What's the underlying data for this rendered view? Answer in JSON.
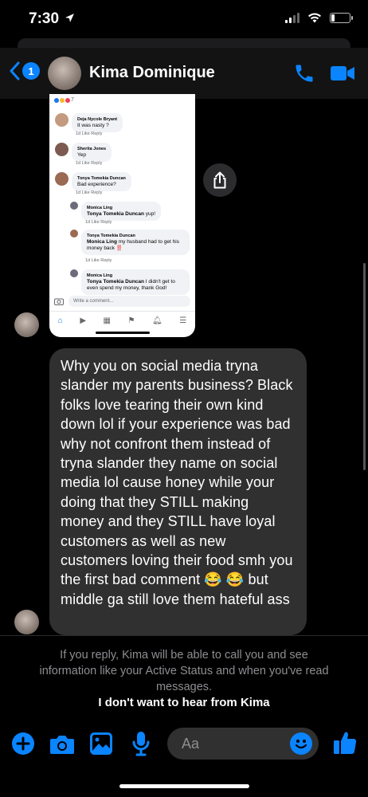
{
  "status_bar": {
    "time": "7:30"
  },
  "header": {
    "back_badge": "1",
    "contact_name": "Kima Dominique"
  },
  "shared_screenshot": {
    "reaction_count": "7",
    "comments": [
      {
        "name": "Deja Nycole Bryant",
        "text": "It was nasty ?",
        "meta": "1d   Like   Reply"
      },
      {
        "name": "Sherita Jones",
        "text": "Yep",
        "meta": "1d   Like   Reply"
      },
      {
        "name": "Tonya Tomekia Duncan",
        "text": "Bad experience?",
        "meta": "1d   Like   Reply"
      }
    ],
    "replies": [
      {
        "name": "Monica Ling",
        "mention": "Tonya Tomekia Duncan",
        "text": " yup!",
        "meta": "1d   Like   Reply"
      },
      {
        "name": "Tonya Tomekia Duncan",
        "mention": "Monica Ling",
        "text": " my husband had to get his money back ‼️",
        "meta": "1d   Like   Reply"
      },
      {
        "name": "Monica Ling",
        "mention": "Tonya Tomekia Duncan",
        "text": " I didn't get to even spend my money, thank God!"
      }
    ],
    "write_placeholder": "Write a comment..."
  },
  "message": {
    "text": "Why you on social media tryna slander my parents business? Black folks love tearing their own kind down lol if your experience was bad why not confront them instead of tryna slander they name on social media lol cause honey while your doing that they STILL making money and they STILL have loyal customers as well as new customers loving their food smh you the first bad comment 😂 😂 but middle ga still love them hateful ass"
  },
  "notice": {
    "text": "If you reply, Kima will be able to call you and see information like your Active Status and when you've read messages.",
    "block_label": "I don't want to hear from Kima"
  },
  "composer": {
    "placeholder": "Aa"
  },
  "colors": {
    "accent": "#0a84ff",
    "bubble": "#303030",
    "background": "#000000"
  }
}
